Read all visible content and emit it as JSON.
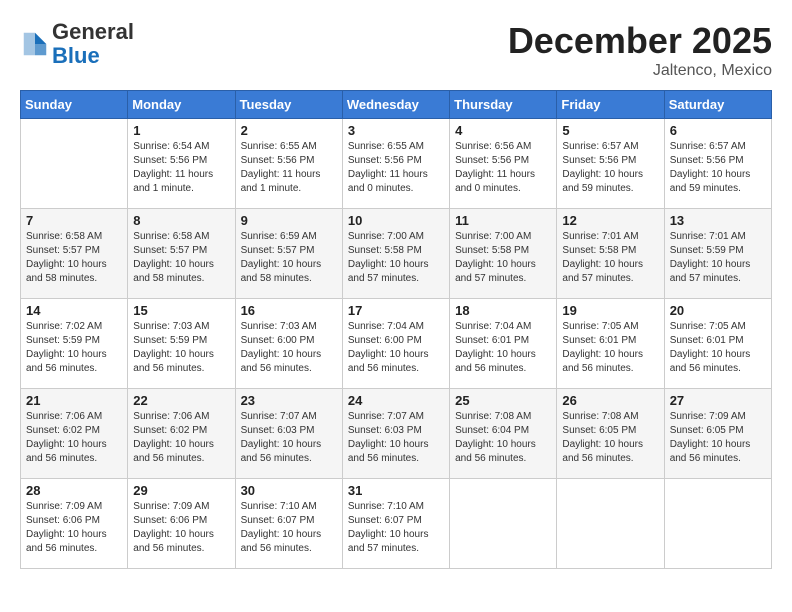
{
  "header": {
    "logo_general": "General",
    "logo_blue": "Blue",
    "month_title": "December 2025",
    "location": "Jaltenco, Mexico"
  },
  "days_of_week": [
    "Sunday",
    "Monday",
    "Tuesday",
    "Wednesday",
    "Thursday",
    "Friday",
    "Saturday"
  ],
  "weeks": [
    [
      {
        "day": "",
        "info": ""
      },
      {
        "day": "1",
        "info": "Sunrise: 6:54 AM\nSunset: 5:56 PM\nDaylight: 11 hours\nand 1 minute."
      },
      {
        "day": "2",
        "info": "Sunrise: 6:55 AM\nSunset: 5:56 PM\nDaylight: 11 hours\nand 1 minute."
      },
      {
        "day": "3",
        "info": "Sunrise: 6:55 AM\nSunset: 5:56 PM\nDaylight: 11 hours\nand 0 minutes."
      },
      {
        "day": "4",
        "info": "Sunrise: 6:56 AM\nSunset: 5:56 PM\nDaylight: 11 hours\nand 0 minutes."
      },
      {
        "day": "5",
        "info": "Sunrise: 6:57 AM\nSunset: 5:56 PM\nDaylight: 10 hours\nand 59 minutes."
      },
      {
        "day": "6",
        "info": "Sunrise: 6:57 AM\nSunset: 5:56 PM\nDaylight: 10 hours\nand 59 minutes."
      }
    ],
    [
      {
        "day": "7",
        "info": "Sunrise: 6:58 AM\nSunset: 5:57 PM\nDaylight: 10 hours\nand 58 minutes."
      },
      {
        "day": "8",
        "info": "Sunrise: 6:58 AM\nSunset: 5:57 PM\nDaylight: 10 hours\nand 58 minutes."
      },
      {
        "day": "9",
        "info": "Sunrise: 6:59 AM\nSunset: 5:57 PM\nDaylight: 10 hours\nand 58 minutes."
      },
      {
        "day": "10",
        "info": "Sunrise: 7:00 AM\nSunset: 5:58 PM\nDaylight: 10 hours\nand 57 minutes."
      },
      {
        "day": "11",
        "info": "Sunrise: 7:00 AM\nSunset: 5:58 PM\nDaylight: 10 hours\nand 57 minutes."
      },
      {
        "day": "12",
        "info": "Sunrise: 7:01 AM\nSunset: 5:58 PM\nDaylight: 10 hours\nand 57 minutes."
      },
      {
        "day": "13",
        "info": "Sunrise: 7:01 AM\nSunset: 5:59 PM\nDaylight: 10 hours\nand 57 minutes."
      }
    ],
    [
      {
        "day": "14",
        "info": "Sunrise: 7:02 AM\nSunset: 5:59 PM\nDaylight: 10 hours\nand 56 minutes."
      },
      {
        "day": "15",
        "info": "Sunrise: 7:03 AM\nSunset: 5:59 PM\nDaylight: 10 hours\nand 56 minutes."
      },
      {
        "day": "16",
        "info": "Sunrise: 7:03 AM\nSunset: 6:00 PM\nDaylight: 10 hours\nand 56 minutes."
      },
      {
        "day": "17",
        "info": "Sunrise: 7:04 AM\nSunset: 6:00 PM\nDaylight: 10 hours\nand 56 minutes."
      },
      {
        "day": "18",
        "info": "Sunrise: 7:04 AM\nSunset: 6:01 PM\nDaylight: 10 hours\nand 56 minutes."
      },
      {
        "day": "19",
        "info": "Sunrise: 7:05 AM\nSunset: 6:01 PM\nDaylight: 10 hours\nand 56 minutes."
      },
      {
        "day": "20",
        "info": "Sunrise: 7:05 AM\nSunset: 6:01 PM\nDaylight: 10 hours\nand 56 minutes."
      }
    ],
    [
      {
        "day": "21",
        "info": "Sunrise: 7:06 AM\nSunset: 6:02 PM\nDaylight: 10 hours\nand 56 minutes."
      },
      {
        "day": "22",
        "info": "Sunrise: 7:06 AM\nSunset: 6:02 PM\nDaylight: 10 hours\nand 56 minutes."
      },
      {
        "day": "23",
        "info": "Sunrise: 7:07 AM\nSunset: 6:03 PM\nDaylight: 10 hours\nand 56 minutes."
      },
      {
        "day": "24",
        "info": "Sunrise: 7:07 AM\nSunset: 6:03 PM\nDaylight: 10 hours\nand 56 minutes."
      },
      {
        "day": "25",
        "info": "Sunrise: 7:08 AM\nSunset: 6:04 PM\nDaylight: 10 hours\nand 56 minutes."
      },
      {
        "day": "26",
        "info": "Sunrise: 7:08 AM\nSunset: 6:05 PM\nDaylight: 10 hours\nand 56 minutes."
      },
      {
        "day": "27",
        "info": "Sunrise: 7:09 AM\nSunset: 6:05 PM\nDaylight: 10 hours\nand 56 minutes."
      }
    ],
    [
      {
        "day": "28",
        "info": "Sunrise: 7:09 AM\nSunset: 6:06 PM\nDaylight: 10 hours\nand 56 minutes."
      },
      {
        "day": "29",
        "info": "Sunrise: 7:09 AM\nSunset: 6:06 PM\nDaylight: 10 hours\nand 56 minutes."
      },
      {
        "day": "30",
        "info": "Sunrise: 7:10 AM\nSunset: 6:07 PM\nDaylight: 10 hours\nand 56 minutes."
      },
      {
        "day": "31",
        "info": "Sunrise: 7:10 AM\nSunset: 6:07 PM\nDaylight: 10 hours\nand 57 minutes."
      },
      {
        "day": "",
        "info": ""
      },
      {
        "day": "",
        "info": ""
      },
      {
        "day": "",
        "info": ""
      }
    ]
  ]
}
